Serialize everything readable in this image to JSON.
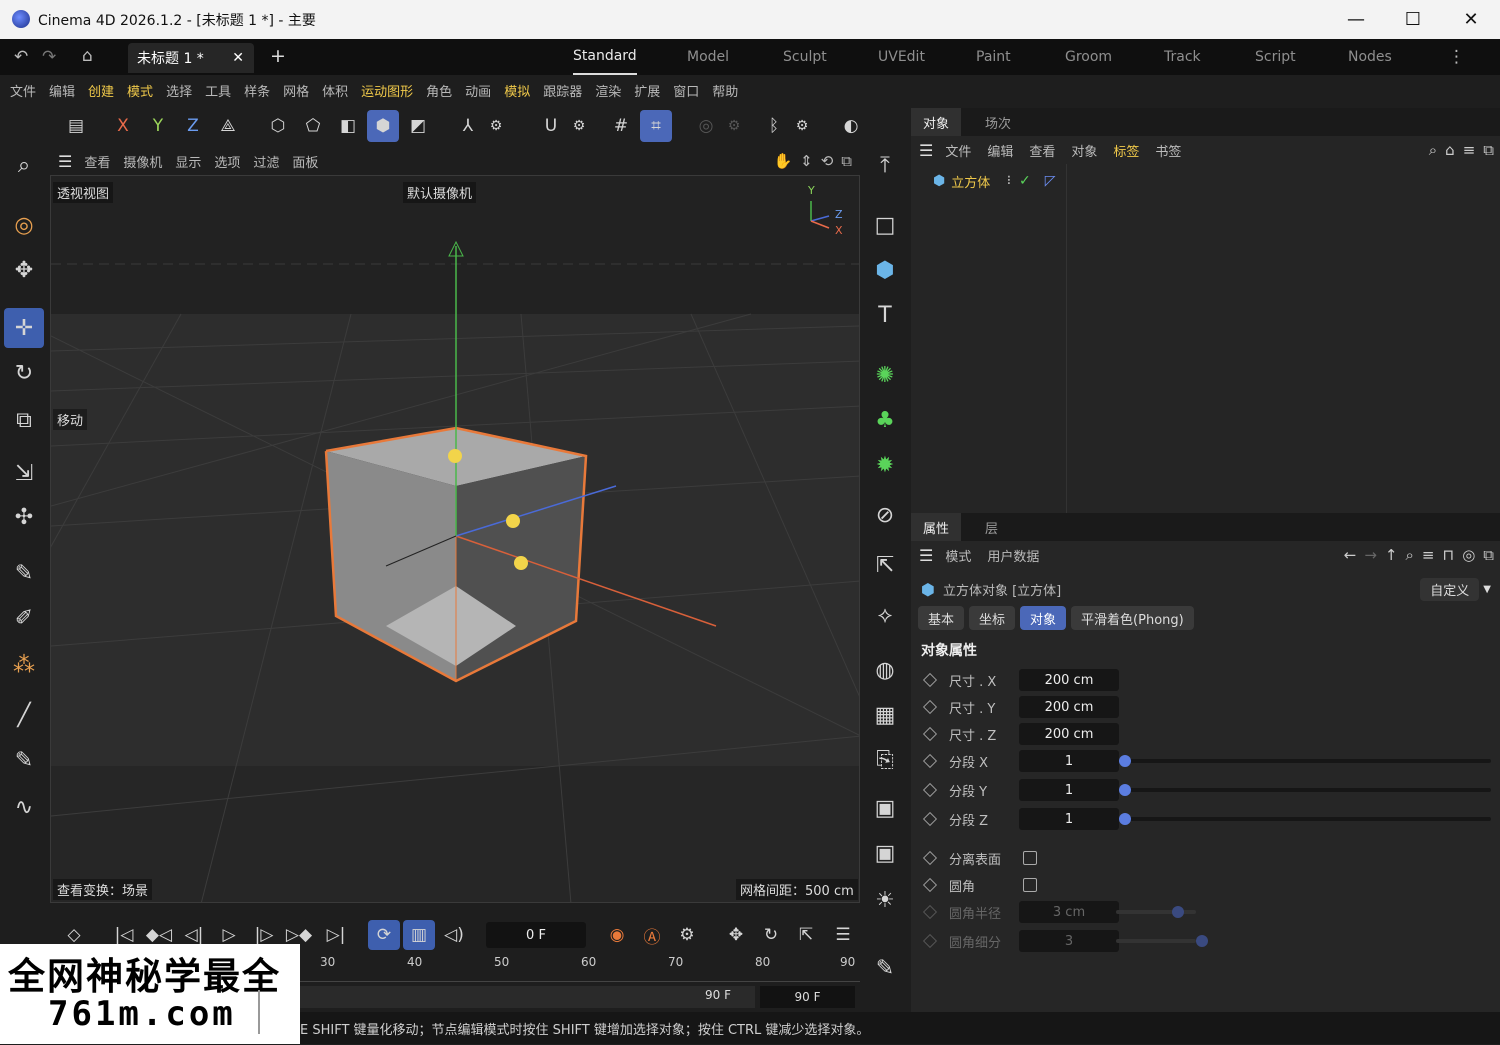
{
  "window": {
    "title": "Cinema 4D 2026.1.2 - [未标题 1 *] - 主要",
    "minimize": "—",
    "maximize": "☐",
    "close": "✕"
  },
  "topbar": {
    "doc_tab": "未标题 1 *",
    "doc_tab_close": "✕",
    "add_tab": "+",
    "layouts": [
      "Standard",
      "Model",
      "Sculpt",
      "UVEdit",
      "Paint",
      "Groom",
      "Track",
      "Script",
      "Nodes"
    ],
    "active_layout": "Standard",
    "more": "⋮"
  },
  "menus": [
    "文件",
    "编辑",
    "创建",
    "模式",
    "选择",
    "工具",
    "样条",
    "网格",
    "体积",
    "运动图形",
    "角色",
    "动画",
    "模拟",
    "跟踪器",
    "渲染",
    "扩展",
    "窗口",
    "帮助"
  ],
  "menus_highlight": [
    "创建",
    "模式",
    "运动图形",
    "模拟"
  ],
  "toolbar": {
    "x": "X",
    "y": "Y",
    "z": "Z"
  },
  "viewport": {
    "menus": [
      "查看",
      "摄像机",
      "显示",
      "选项",
      "过滤",
      "面板"
    ],
    "name": "透视视图",
    "camera": "默认摄像机",
    "tool_label": "移动",
    "transform_label": "查看变换：场景",
    "grid_label": "网格间距：500 cm",
    "axis_y": "Y",
    "axis_z": "Z",
    "axis_x": "X"
  },
  "object_manager": {
    "tabs": [
      "对象",
      "场次"
    ],
    "menus": [
      "文件",
      "编辑",
      "查看",
      "对象",
      "标签",
      "书签"
    ],
    "highlight_menu": "标签",
    "object_name": "立方体",
    "check": "✓"
  },
  "attributes": {
    "tabs": [
      "属性",
      "层"
    ],
    "menus": [
      "模式",
      "用户数据"
    ],
    "object_title": "立方体对象 [立方体]",
    "preset": "自定义",
    "subtabs": [
      "基本",
      "坐标",
      "对象",
      "平滑着色(Phong)"
    ],
    "active_subtab": "对象",
    "section": "对象属性",
    "size": [
      {
        "label": "尺寸 . X",
        "value": "200 cm"
      },
      {
        "label": "尺寸 . Y",
        "value": "200 cm"
      },
      {
        "label": "尺寸 . Z",
        "value": "200 cm"
      }
    ],
    "segments": [
      {
        "label": "分段 X",
        "value": "1"
      },
      {
        "label": "分段 Y",
        "value": "1"
      },
      {
        "label": "分段 Z",
        "value": "1"
      }
    ],
    "separate_surfaces": "分离表面",
    "fillet": "圆角",
    "fillet_radius": {
      "label": "圆角半径",
      "value": "3 cm"
    },
    "fillet_subdiv": {
      "label": "圆角细分",
      "value": "3"
    }
  },
  "timeline": {
    "current_frame": "0 F",
    "ruler": [
      "30",
      "40",
      "50",
      "60",
      "70",
      "80",
      "90"
    ],
    "end_a": "90 F",
    "end_b": "90 F"
  },
  "status": "E SHIFT 键量化移动；节点编辑模式时按住 SHIFT 键增加选择对象；按住 CTRL 键减少选择对象。",
  "watermark": {
    "line1": "全网神秘学最全",
    "line2": "761m.com"
  },
  "colors": {
    "accent": "#4b68b8",
    "highlight": "#f0c94a",
    "selection": "#e8793a"
  }
}
